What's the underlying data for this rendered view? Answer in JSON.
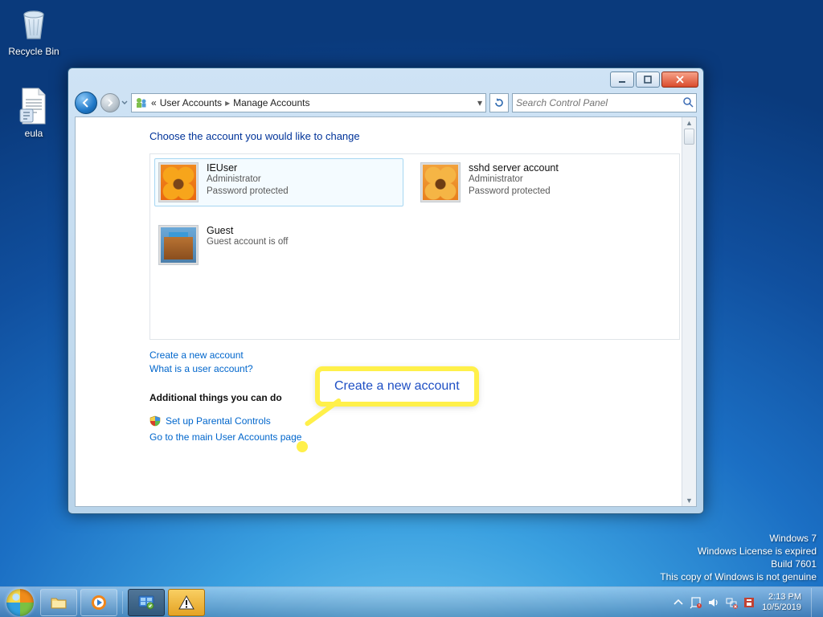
{
  "desktop": {
    "icons": {
      "recycle_bin": "Recycle Bin",
      "eula": "eula"
    },
    "watermark": {
      "l1": "Windows 7",
      "l2": "Windows License is expired",
      "l3": "Build 7601",
      "l4": "This copy of Windows is not genuine"
    }
  },
  "window": {
    "breadcrumb": {
      "prefix": "«",
      "seg1": "User Accounts",
      "seg2": "Manage Accounts"
    },
    "search_placeholder": "Search Control Panel",
    "heading": "Choose the account you would like to change",
    "accounts": [
      {
        "name": "IEUser",
        "role": "Administrator",
        "note": "Password protected"
      },
      {
        "name": "sshd server account",
        "role": "Administrator",
        "note": "Password protected"
      },
      {
        "name": "Guest",
        "role": "Guest account is off",
        "note": ""
      }
    ],
    "links": {
      "create": "Create a new account",
      "whatis": "What is a user account?",
      "additional_h": "Additional things you can do",
      "parental": "Set up Parental Controls",
      "main": "Go to the main User Accounts page"
    },
    "callout_text": "Create a new account"
  },
  "taskbar": {
    "clock_time": "2:13 PM",
    "clock_date": "10/5/2019"
  }
}
